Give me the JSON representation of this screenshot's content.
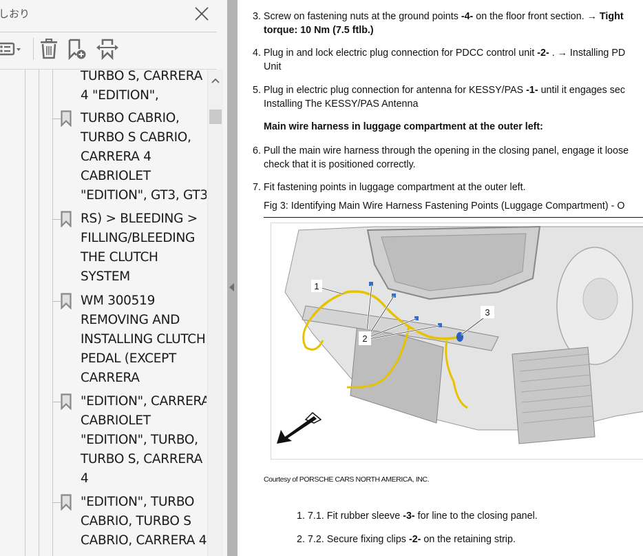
{
  "bookmarks_panel": {
    "title": "しおり",
    "close_icon": "close-icon",
    "toolbar": [
      {
        "name": "options-menu",
        "icon": "list-options-icon"
      },
      {
        "name": "delete-bookmark",
        "icon": "trash-icon"
      },
      {
        "name": "new-bookmark",
        "icon": "bookmark-add-icon"
      },
      {
        "name": "expand-bookmark",
        "icon": "bookmark-expand-icon"
      }
    ],
    "items": [
      {
        "text": "TURBO S, CARRERA\n4 \"EDITION\","
      },
      {
        "text": "TURBO CABRIO,\nTURBO S CABRIO,\nCARRERA 4\nCABRIOLET\n\"EDITION\", GT3, GT3"
      },
      {
        "text": "RS) > BLEEDING >\nFILLING/BLEEDING\nTHE CLUTCH\nSYSTEM"
      },
      {
        "text": "WM 300519\nREMOVING AND\nINSTALLING CLUTCH\nPEDAL (EXCEPT\nCARRERA"
      },
      {
        "text": "\"EDITION\", CARRERA\nCABRIOLET\n\"EDITION\", TURBO,\nTURBO S, CARRERA\n4"
      },
      {
        "text": "\"EDITION\", TURBO\nCABRIO, TURBO S\nCABRIO, CARRERA 4"
      }
    ]
  },
  "document": {
    "steps": [
      {
        "num": "3.",
        "line1_pre": "Screw on fastening nuts at the ground points ",
        "line1_bold": "-4-",
        "line1_post": "  on the floor front section. → ",
        "line1_bold2": "Tight",
        "line2_bold": "torque: 10 Nm (7.5 ftlb.)"
      },
      {
        "num": "4.",
        "line1_pre": "Plug in and lock electric plug connection for PDCC control unit ",
        "line1_bold": "-2-",
        "line1_post": "  . → Installing PD",
        "line2": "Unit"
      },
      {
        "num": "5.",
        "line1_pre": "Plug in electric plug connection for antenna for KESSY/PAS ",
        "line1_bold": "-1-",
        "line1_post": "  until it engages sec",
        "line2": "Installing The KESSY/PAS Antenna"
      }
    ],
    "section_heading": "Main wire harness in luggage compartment at the outer left:",
    "steps2": [
      {
        "num": "6.",
        "line1": "Pull the main wire harness through the opening in the closing panel, engage it loose",
        "line2": "check that it is positioned correctly."
      },
      {
        "num": "7.",
        "line1": "Fit fastening points in luggage compartment at the outer left."
      }
    ],
    "figure_caption": "Fig 3: Identifying Main Wire Harness Fastening Points (Luggage Compartment) - O",
    "figure_callouts": [
      "1",
      "2",
      "3"
    ],
    "courtesy": "Courtesy of PORSCHE CARS NORTH AMERICA, INC.",
    "substeps": [
      {
        "num": "1.",
        "pre": "7.1. Fit rubber sleeve ",
        "bold": "-3-",
        "post": "  for line to the closing panel."
      },
      {
        "num": "2.",
        "pre": "7.2. Secure fixing clips ",
        "bold": "-2-",
        "post": "  on the retaining strip."
      }
    ]
  }
}
